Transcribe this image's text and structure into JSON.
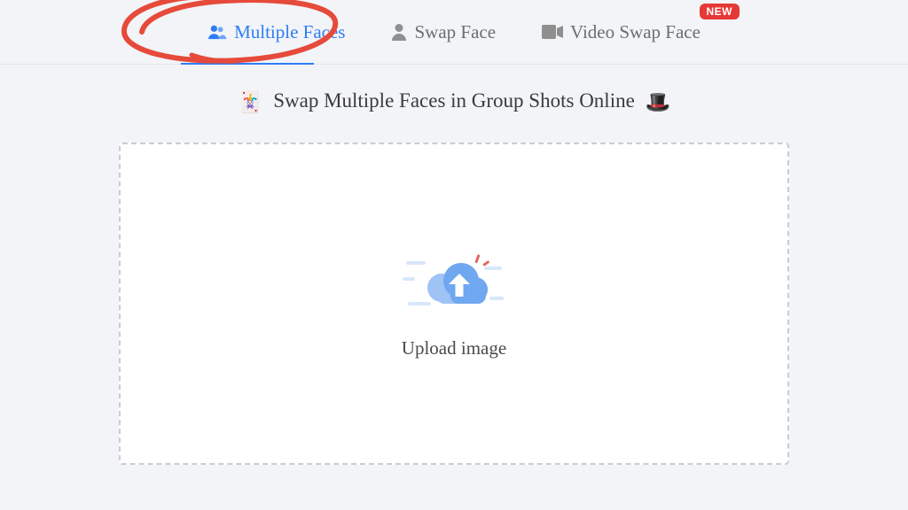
{
  "tabs": {
    "multipleFaces": {
      "label": "Multiple Faces"
    },
    "swapFace": {
      "label": "Swap Face"
    },
    "videoSwap": {
      "label": "Video Swap Face"
    }
  },
  "badge": {
    "new": "NEW"
  },
  "headline": {
    "text": "Swap Multiple Faces in Group Shots Online",
    "emoji_left": "🃏",
    "emoji_right": "🎩"
  },
  "dropzone": {
    "label": "Upload image"
  },
  "colors": {
    "accent": "#2f7df6",
    "badge": "#e53935",
    "border": "#c9ccd2"
  }
}
